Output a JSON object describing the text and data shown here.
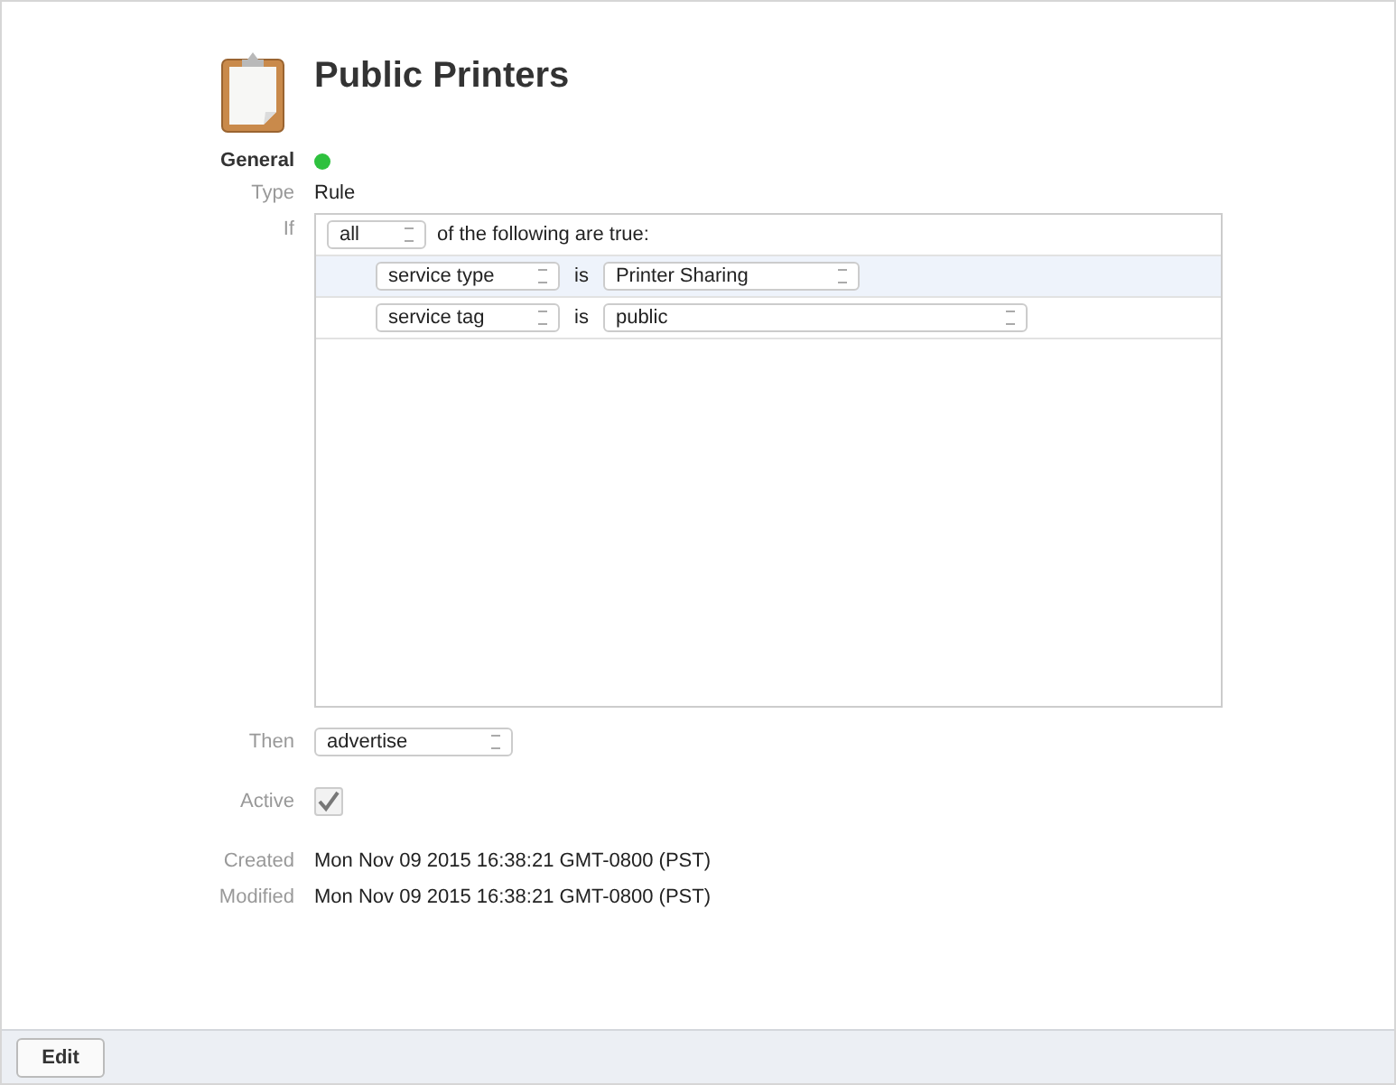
{
  "title": "Public Printers",
  "general": {
    "label": "General",
    "enabled": true
  },
  "type": {
    "label": "Type",
    "value": "Rule"
  },
  "if": {
    "label": "If",
    "match": "all",
    "suffix": "of the following are true:",
    "rules": [
      {
        "field": "service type",
        "operator": "is",
        "value": "Printer Sharing",
        "selected": true
      },
      {
        "field": "service tag",
        "operator": "is",
        "value": "public",
        "selected": false
      }
    ]
  },
  "then": {
    "label": "Then",
    "value": "advertise"
  },
  "active": {
    "label": "Active",
    "checked": true,
    "disabled": true
  },
  "created": {
    "label": "Created",
    "value": "Mon Nov 09 2015 16:38:21 GMT-0800 (PST)"
  },
  "modified": {
    "label": "Modified",
    "value": "Mon Nov 09 2015 16:38:21 GMT-0800 (PST)"
  },
  "footer": {
    "button": "Edit"
  }
}
